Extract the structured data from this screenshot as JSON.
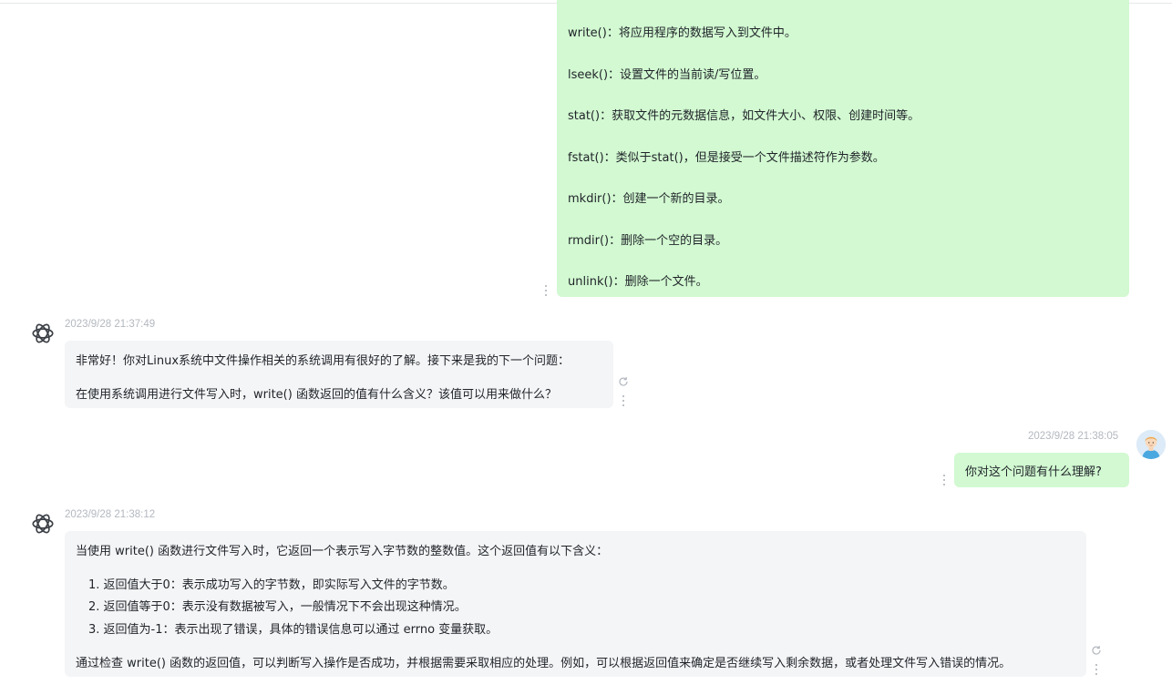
{
  "messages": {
    "user_1": {
      "lines": [
        "write()：将应用程序的数据写入到文件中。",
        "lseek()：设置文件的当前读/写位置。",
        "stat()：获取文件的元数据信息，如文件大小、权限、创建时间等。",
        "fstat()：类似于stat()，但是接受一个文件描述符作为参数。",
        "mkdir()：创建一个新的目录。",
        "rmdir()：删除一个空的目录。",
        "unlink()：删除一个文件。"
      ]
    },
    "ai_1": {
      "timestamp": "2023/9/28 21:37:49",
      "lines": [
        "非常好！你对Linux系统中文件操作相关的系统调用有很好的了解。接下来是我的下一个问题：",
        "在使用系统调用进行文件写入时，write() 函数返回的值有什么含义？该值可以用来做什么？"
      ]
    },
    "user_2": {
      "timestamp": "2023/9/28 21:38:05",
      "text": "你对这个问题有什么理解?"
    },
    "ai_2": {
      "timestamp": "2023/9/28 21:38:12",
      "intro": "当使用 write() 函数进行文件写入时，它返回一个表示写入字节数的整数值。这个返回值有以下含义：",
      "list": [
        "1. 返回值大于0：表示成功写入的字节数，即实际写入文件的字节数。",
        "2. 返回值等于0：表示没有数据被写入，一般情况下不会出现这种情况。",
        "3. 返回值为-1：表示出现了错误，具体的错误信息可以通过 errno 变量获取。"
      ],
      "outro": "通过检查 write() 函数的返回值，可以判断写入操作是否成功，并根据需要采取相应的处理。例如，可以根据返回值来确定是否继续写入剩余数据，或者处理文件写入错误的情况。"
    }
  },
  "icons": {
    "ai_avatar": "openai-logo-icon",
    "user_avatar": "user-avatar-icon",
    "more": "more-vertical-icon",
    "regenerate": "regenerate-icon"
  },
  "colors": {
    "user_bubble": "#d2f9d1",
    "ai_bubble": "#f4f5f6",
    "timestamp": "#b3b8bf"
  }
}
